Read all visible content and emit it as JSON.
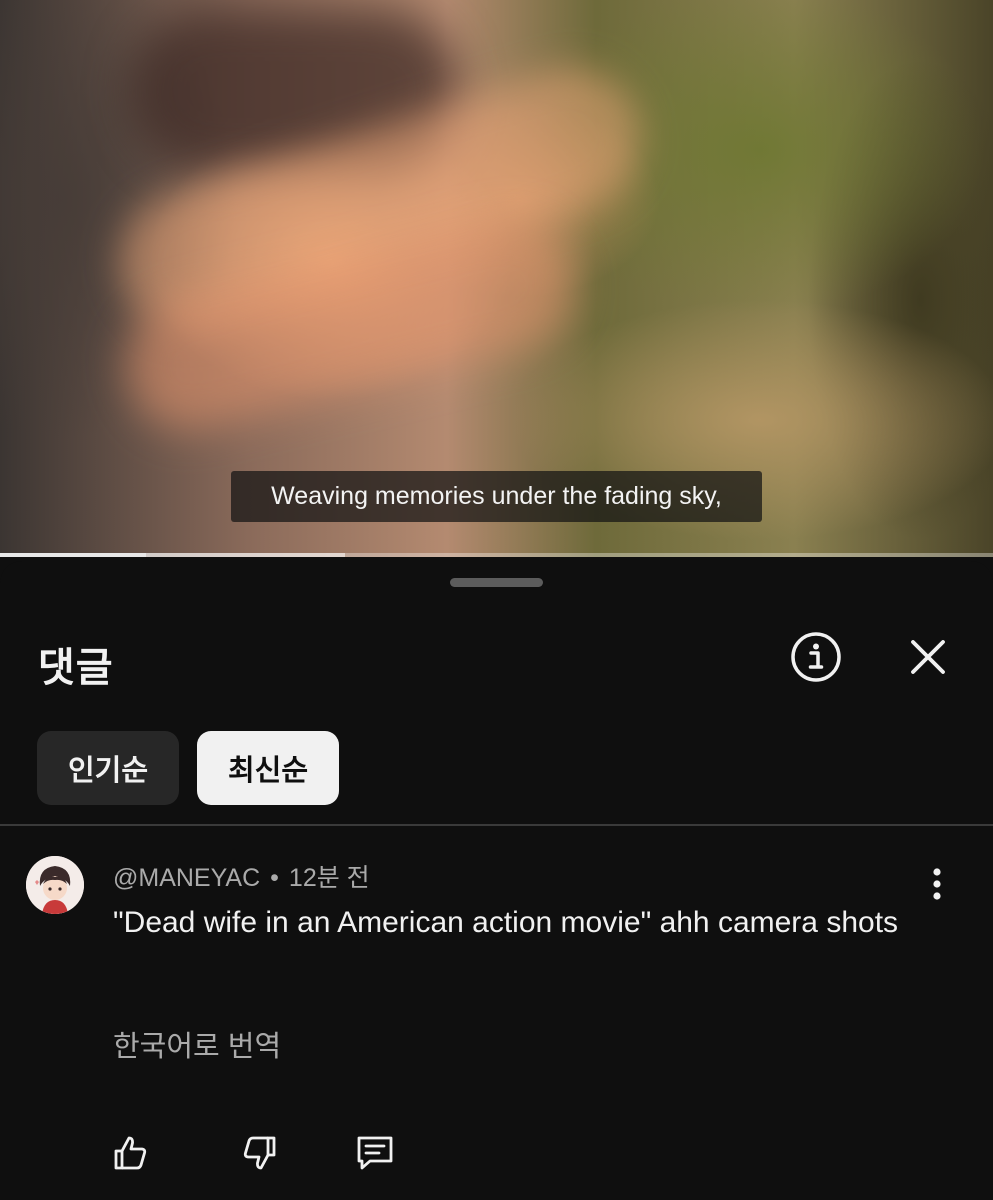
{
  "video": {
    "caption": "Weaving memories under the fading sky,",
    "progress": 0.147,
    "buffered": 0.347
  },
  "comments_panel": {
    "title": "댓글",
    "info_icon": "info-circle-icon",
    "close_icon": "close-icon",
    "sort_chips": [
      {
        "label": "인기순",
        "selected": false
      },
      {
        "label": "최신순",
        "selected": true
      }
    ],
    "comments": [
      {
        "author": "@MANEYAC",
        "separator": "•",
        "time": "12분 전",
        "text": "\"Dead wife in an American action movie\" ahh camera shots",
        "translate_label": "한국어로 번역",
        "actions": [
          "thumbs-up-icon",
          "thumbs-down-icon",
          "reply-icon"
        ]
      }
    ]
  },
  "colors": {
    "background": "#0f0f0f",
    "chip_selected": "#f1f1f1",
    "chip_default": "#272727",
    "secondary_text": "#aaaaaa"
  }
}
